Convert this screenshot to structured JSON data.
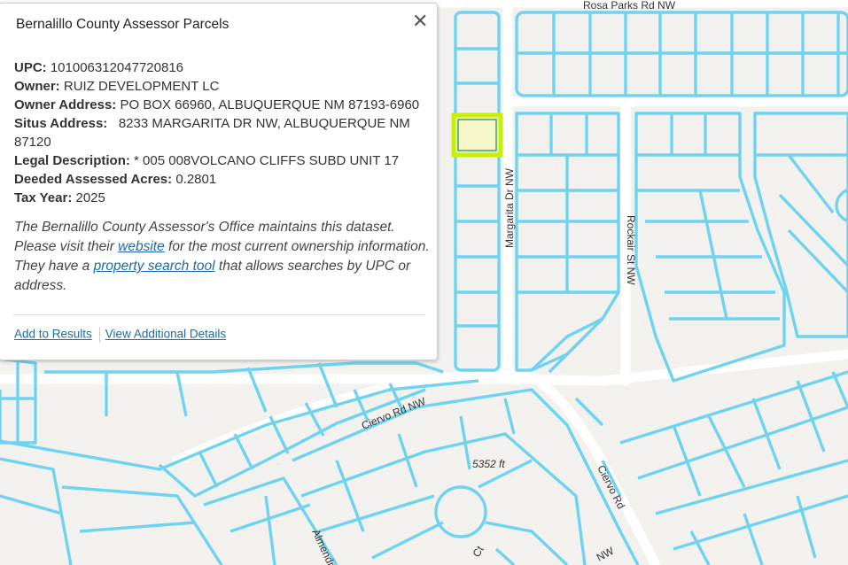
{
  "map": {
    "road_labels": {
      "rosa_parks": "Rosa Parks Rd NW",
      "margarita": "Margarita Dr NW",
      "rockair": "Rockair St NW",
      "ciervo_nw": "Ciervo Rd NW",
      "ciervo_rd": "Ciervo Rd",
      "almendra": "Almendra",
      "ct": "Ct",
      "nw": "NW"
    },
    "elevation": "5352 ft",
    "colors": {
      "parcel": "#6fd3ef",
      "highlight": "#c8f000",
      "background": "#f2f1ee"
    }
  },
  "popup": {
    "title": "Bernalillo County Assessor Parcels",
    "close_icon": "close-icon",
    "fields": [
      {
        "label": "UPC:",
        "value": "101006312047720816"
      },
      {
        "label": "Owner:",
        "value": "RUIZ DEVELOPMENT LC"
      },
      {
        "label": "Owner Address:",
        "value": "PO BOX 66960, ALBUQUERQUE NM 87193-6960"
      },
      {
        "label": "Situs Address:",
        "value": "  8233 MARGARITA DR NW, ALBUQUERQUE NM 87120"
      },
      {
        "label": "Legal Description:",
        "value": "* 005 008VOLCANO CLIFFS SUBD UNIT 17"
      },
      {
        "label": "Deeded Assessed Acres:",
        "value": "0.2801"
      },
      {
        "label": "Tax Year:",
        "value": "2025"
      }
    ],
    "note": {
      "part1": "The Bernalillo County Assessor's Office maintains this dataset. Please visit their ",
      "link1": "website",
      "part2": " for the most current ownership information. They have a ",
      "link2": "property search tool",
      "part3": " that allows searches by UPC or address."
    },
    "actions": {
      "add_to_results": "Add to Results",
      "view_details": "View Additional Details"
    }
  }
}
